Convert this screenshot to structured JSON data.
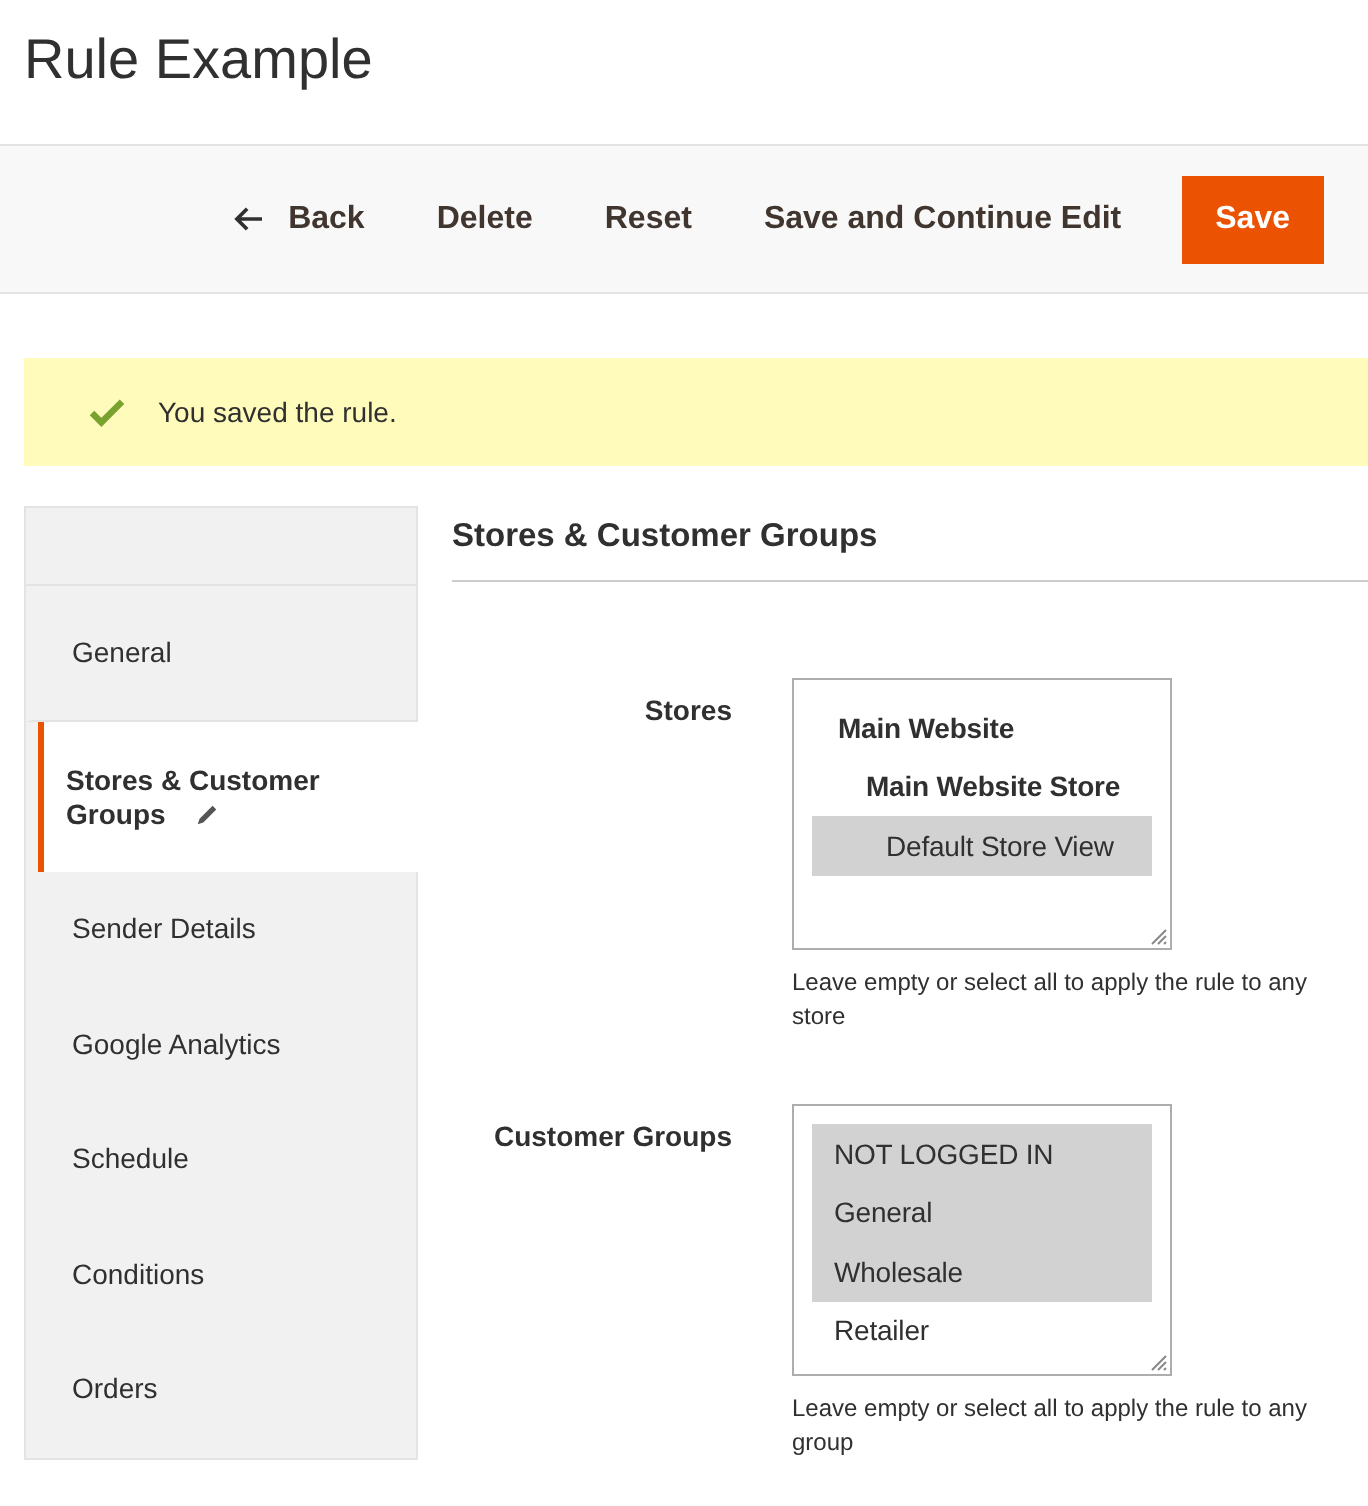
{
  "page": {
    "title": "Rule Example"
  },
  "toolbar": {
    "buttons": [
      {
        "label": "Back",
        "kind": "back"
      },
      {
        "label": "Delete",
        "kind": "plain"
      },
      {
        "label": "Reset",
        "kind": "plain"
      },
      {
        "label": "Save and Continue Edit",
        "kind": "plain"
      },
      {
        "label": "Save",
        "kind": "primary"
      }
    ]
  },
  "message": {
    "success": true,
    "text": "You saved the rule."
  },
  "sidebar": {
    "items": [
      {
        "label": "General",
        "selected": false,
        "edited": false
      },
      {
        "label": "Stores & Customer Groups",
        "selected": true,
        "edited": true
      },
      {
        "label": "Sender Details",
        "selected": false,
        "edited": false
      },
      {
        "label": "Google Analytics",
        "selected": false,
        "edited": false
      },
      {
        "label": "Schedule",
        "selected": false,
        "edited": false
      },
      {
        "label": "Conditions",
        "selected": false,
        "edited": false
      },
      {
        "label": "Orders",
        "selected": false,
        "edited": false
      }
    ]
  },
  "section": {
    "title": "Stores & Customer Groups",
    "fields": [
      {
        "label": "Stores",
        "options": [
          {
            "label": "Main Website",
            "kind": "website",
            "selected": false
          },
          {
            "label": "Main Website Store",
            "kind": "store",
            "selected": false
          },
          {
            "label": "Default Store View",
            "kind": "view",
            "selected": true
          }
        ],
        "note": "Leave empty or select all to apply the rule to any store"
      },
      {
        "label": "Customer Groups",
        "options": [
          {
            "label": "NOT LOGGED IN",
            "kind": "group",
            "selected": true
          },
          {
            "label": "General",
            "kind": "group",
            "selected": true
          },
          {
            "label": "Wholesale",
            "kind": "group",
            "selected": true
          },
          {
            "label": "Retailer",
            "kind": "group",
            "selected": false
          }
        ],
        "note": "Leave empty or select all to apply the rule to any group"
      }
    ]
  }
}
